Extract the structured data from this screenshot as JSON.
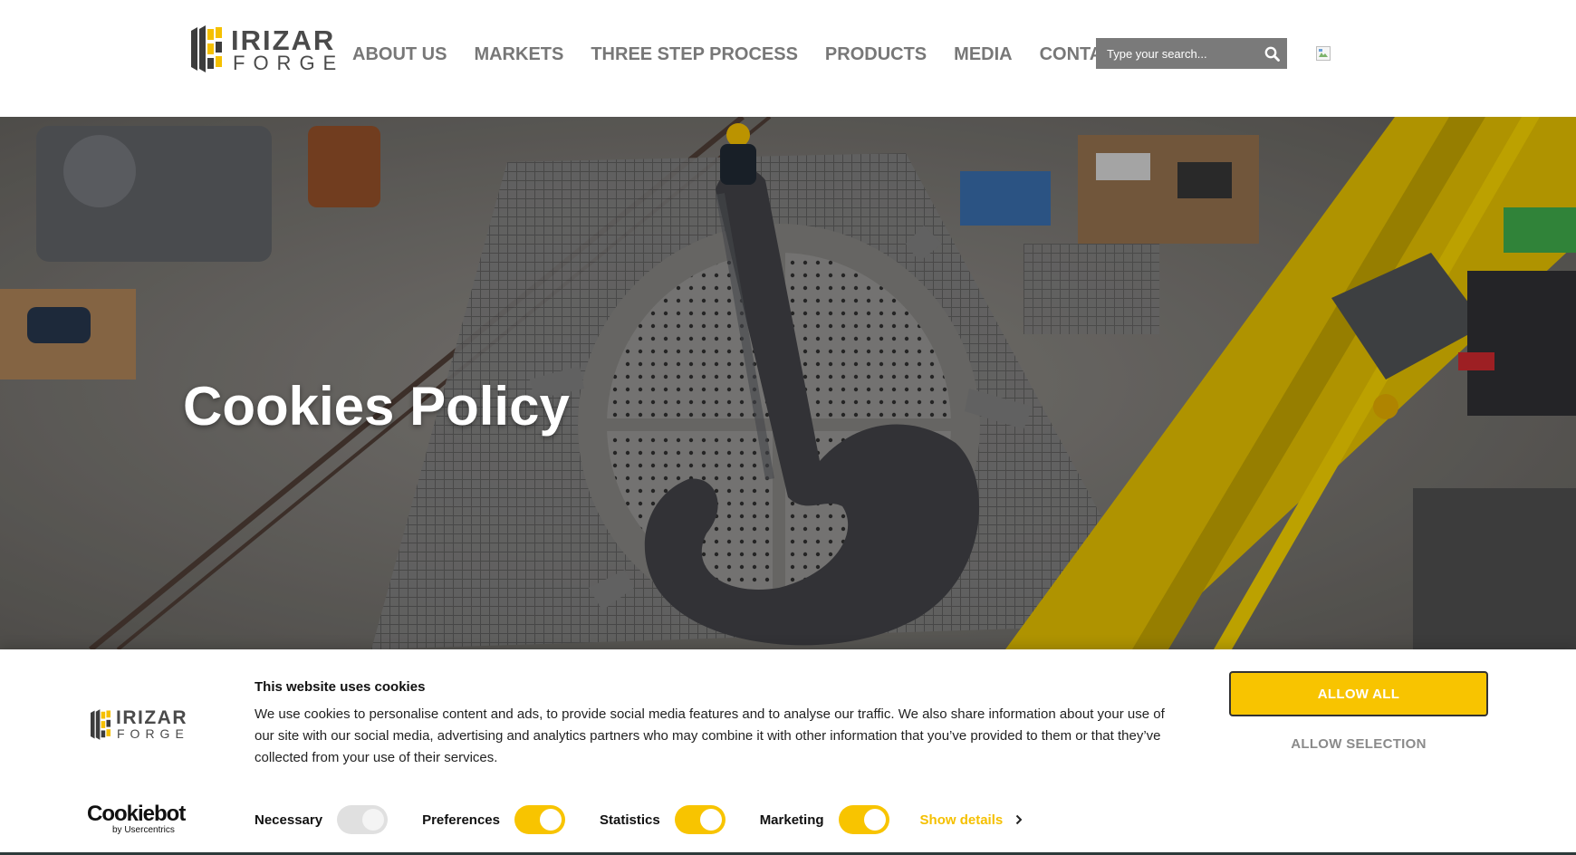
{
  "header": {
    "logo": {
      "line1": "IRIZAR",
      "line2": "FORGE"
    },
    "nav": [
      {
        "label": "ABOUT US"
      },
      {
        "label": "MARKETS"
      },
      {
        "label": "THREE STEP PROCESS"
      },
      {
        "label": "PRODUCTS"
      },
      {
        "label": "MEDIA"
      },
      {
        "label": "CONTACT"
      }
    ],
    "search": {
      "placeholder": "Type your search...",
      "icon": "search-icon"
    },
    "language_flag": {
      "icon": "flag-icon"
    }
  },
  "hero": {
    "title": "Cookies Policy"
  },
  "cookie_banner": {
    "logo": {
      "line1": "IRIZAR",
      "line2": "FORGE"
    },
    "provider": {
      "name": "Cookiebot",
      "byline": "by Usercentrics"
    },
    "title": "This website uses cookies",
    "text": "We use cookies to personalise content and ads, to provide social media features and to analyse our traffic. We also share information about your use of our site with our social media, advertising and analytics partners who may combine it with other information that you’ve provided to them or that they’ve collected from your use of their services.",
    "toggles": [
      {
        "label": "Necessary",
        "state": "on (disabled)"
      },
      {
        "label": "Preferences",
        "state": "on"
      },
      {
        "label": "Statistics",
        "state": "on"
      },
      {
        "label": "Marketing",
        "state": "on"
      }
    ],
    "show_details": "Show details",
    "allow_all": "ALLOW ALL",
    "allow_selection": "ALLOW SELECTION"
  },
  "colors": {
    "accent": "#f8c400",
    "nav_text": "#777777",
    "search_bg": "#7a7a7a",
    "logo_text": "#4a4a4a"
  }
}
